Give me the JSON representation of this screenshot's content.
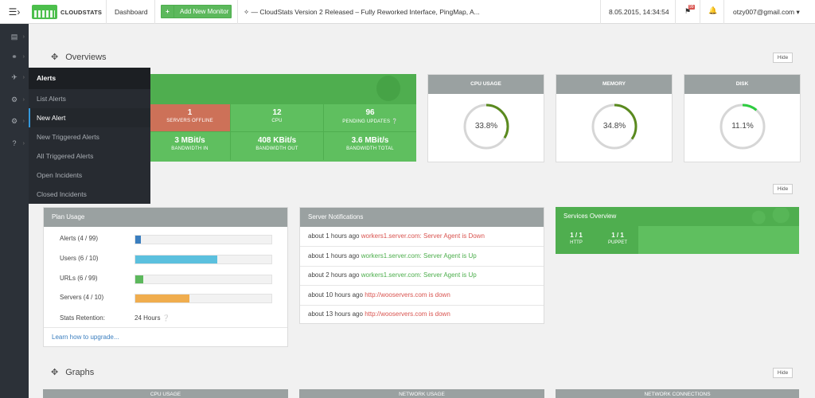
{
  "topbar": {
    "brand": "CLOUDSTATS",
    "dashboard": "Dashboard",
    "add_monitor": "Add New Monitor",
    "news": "— CloudStats Version 2 Released – Fully Reworked Interface, PingMap, A...",
    "datetime": "8.05.2015, 14:34:54",
    "flag_badge": "99",
    "user": "otzy007@gmail.com"
  },
  "flyout": {
    "title": "Alerts",
    "items": [
      "List Alerts",
      "New Alert",
      "New Triggered Alerts",
      "All Triggered Alerts",
      "Open Incidents",
      "Closed Incidents"
    ],
    "active_index": 1
  },
  "sections": {
    "overviews": "Overviews",
    "graphs": "Graphs",
    "hide": "Hide"
  },
  "stats": {
    "servers_offline": {
      "value": "1",
      "label": "SERVERS OFFLINE"
    },
    "cpu": {
      "value": "12",
      "label": "CPU"
    },
    "pending_updates": {
      "value": "96",
      "label": "PENDING UPDATES"
    },
    "bandwidth_in": {
      "value": "3 MBit/s",
      "label": "BANDWIDTH IN"
    },
    "bandwidth_out": {
      "value": "408 KBit/s",
      "label": "BANDWIDTH OUT"
    },
    "bandwidth_total": {
      "value": "3.6 MBit/s",
      "label": "BANDWIDTH TOTAL"
    }
  },
  "gauges": [
    {
      "title": "CPU USAGE",
      "value": "33.8%",
      "fraction": 0.338,
      "color": "#5a8a1e"
    },
    {
      "title": "MEMORY",
      "value": "34.8%",
      "fraction": 0.348,
      "color": "#5a8a1e"
    },
    {
      "title": "DISK",
      "value": "11.1%",
      "fraction": 0.111,
      "color": "#2ecc40"
    }
  ],
  "plan": {
    "title": "Plan Usage",
    "rows": [
      {
        "label": "Alerts (4 / 99)",
        "fraction": 0.0404,
        "color": "#3a7ebf"
      },
      {
        "label": "Users (6 / 10)",
        "fraction": 0.6,
        "color": "#5bc0de"
      },
      {
        "label": "URLs (6 / 99)",
        "fraction": 0.0606,
        "color": "#5cb85c"
      },
      {
        "label": "Servers (4 / 10)",
        "fraction": 0.4,
        "color": "#f0ad4e"
      }
    ],
    "retention_label": "Stats Retention:",
    "retention_value": "24 Hours",
    "upgrade_link": "Learn how to upgrade..."
  },
  "notifications": {
    "title": "Server Notifications",
    "items": [
      {
        "time": "about 1 hours ago",
        "message": "workers1.server.com: Server Agent is Down",
        "status": "bad"
      },
      {
        "time": "about 1 hours ago",
        "message": "workers1.server.com: Server Agent is Up",
        "status": "good"
      },
      {
        "time": "about 2 hours ago",
        "message": "workers1.server.com: Server Agent is Up",
        "status": "good"
      },
      {
        "time": "about 10 hours ago",
        "message": "http://wooservers.com is down",
        "status": "bad"
      },
      {
        "time": "about 13 hours ago",
        "message": "http://wooservers.com is down",
        "status": "bad"
      }
    ]
  },
  "services": {
    "title": "Services Overview",
    "items": [
      {
        "value": "1 / 1",
        "label": "HTTP"
      },
      {
        "value": "1 / 1",
        "label": "PUPPET"
      }
    ]
  },
  "graphs": [
    "CPU USAGE",
    "NETWORK USAGE",
    "NETWORK CONNECTIONS"
  ]
}
